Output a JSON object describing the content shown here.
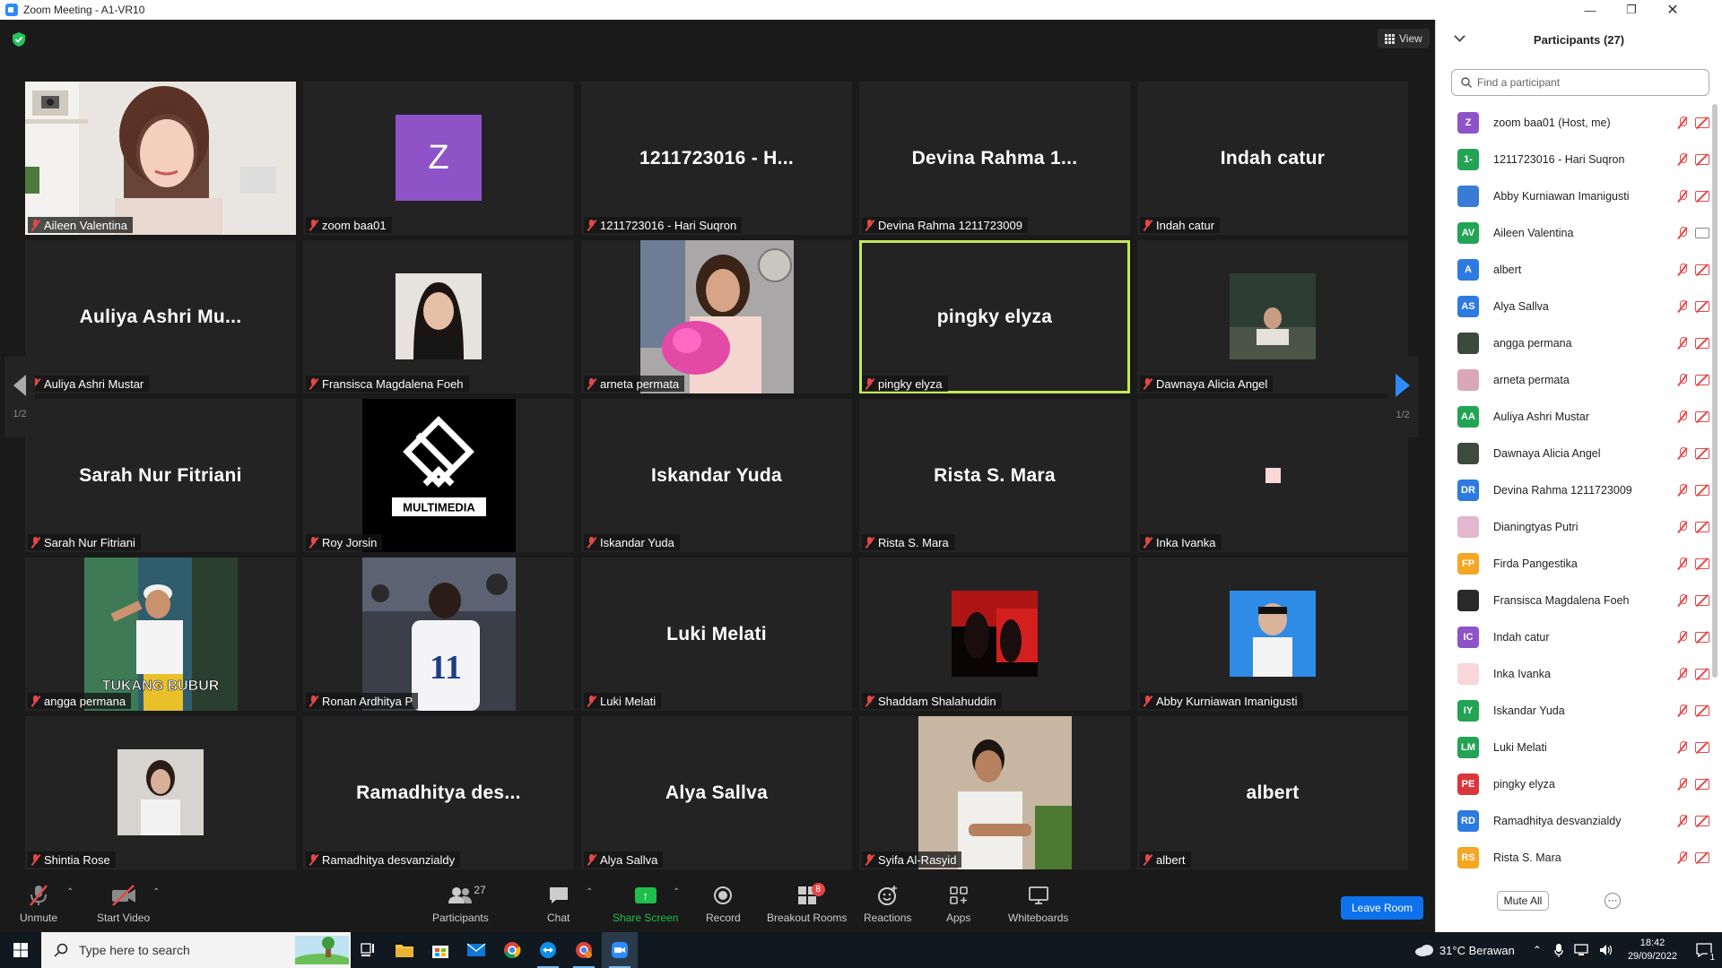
{
  "window": {
    "title": "Zoom Meeting - A1-VR10"
  },
  "meeting": {
    "view_label": "View",
    "page_indicator_left": "1/2",
    "page_indicator_right": "1/2",
    "tiles": [
      {
        "name": "Aileen Valentina",
        "big": "",
        "kind": "photo-aileen"
      },
      {
        "name": "zoom baa01",
        "big": "",
        "kind": "avatar-z",
        "avatar_letter": "Z"
      },
      {
        "name": "1211723016 - Hari Suqron",
        "big": "1211723016 - H...",
        "kind": "name"
      },
      {
        "name": "Devina Rahma 1211723009",
        "big": "Devina Rahma 1...",
        "kind": "name"
      },
      {
        "name": "Indah catur",
        "big": "Indah catur",
        "kind": "name"
      },
      {
        "name": "Auliya Ashri Mustar",
        "big": "Auliya Ashri Mu...",
        "kind": "name"
      },
      {
        "name": "Fransisca Magdalena Foeh",
        "big": "",
        "kind": "photo-fransisca"
      },
      {
        "name": "arneta permata",
        "big": "",
        "kind": "photo-arneta"
      },
      {
        "name": "pingky elyza",
        "big": "pingky elyza",
        "kind": "name",
        "active": true
      },
      {
        "name": "Dawnaya Alicia Angel",
        "big": "",
        "kind": "photo-dawnaya"
      },
      {
        "name": "Sarah Nur Fitriani",
        "big": "Sarah Nur Fitriani",
        "kind": "name"
      },
      {
        "name": "Roy Jorsin",
        "big": "",
        "kind": "photo-roy",
        "logo_text": "MULTIMEDIA"
      },
      {
        "name": "Iskandar Yuda",
        "big": "Iskandar Yuda",
        "kind": "name"
      },
      {
        "name": "Rista S. Mara",
        "big": "Rista S. Mara",
        "kind": "name"
      },
      {
        "name": "Inka Ivanka",
        "big": "",
        "kind": "pink-square"
      },
      {
        "name": "angga permana",
        "big": "",
        "kind": "photo-angga",
        "overlay_text": "TUKANG BUBUR"
      },
      {
        "name": "Ronan Ardhitya P",
        "big": "",
        "kind": "photo-ronan",
        "jersey_number": "11"
      },
      {
        "name": "Luki Melati",
        "big": "Luki Melati",
        "kind": "name"
      },
      {
        "name": "Shaddam Shalahuddin",
        "big": "",
        "kind": "photo-shaddam"
      },
      {
        "name": "Abby Kurniawan Imanigusti",
        "big": "",
        "kind": "photo-abby"
      },
      {
        "name": "Shintia Rose",
        "big": "",
        "kind": "photo-shintia"
      },
      {
        "name": "Ramadhitya desvanzialdy",
        "big": "Ramadhitya des...",
        "kind": "name"
      },
      {
        "name": "Alya Sallva",
        "big": "Alya Sallva",
        "kind": "name"
      },
      {
        "name": "Syifa Al-Rasyid",
        "big": "",
        "kind": "photo-syifa"
      },
      {
        "name": "albert",
        "big": "albert",
        "kind": "name"
      }
    ]
  },
  "toolbar": {
    "unmute": "Unmute",
    "start_video": "Start Video",
    "participants": "Participants",
    "participants_count": "27",
    "chat": "Chat",
    "share_screen": "Share Screen",
    "record": "Record",
    "breakout_rooms": "Breakout Rooms",
    "breakout_badge": "8",
    "reactions": "Reactions",
    "apps": "Apps",
    "whiteboards": "Whiteboards",
    "leave": "Leave Room"
  },
  "panel": {
    "title": "Participants (27)",
    "search_placeholder": "Find a participant",
    "mute_all": "Mute All",
    "participants": [
      {
        "name": "zoom baa01 (Host, me)",
        "initials": "Z",
        "color": "#8e54c7",
        "camera_on": false
      },
      {
        "name": "1211723016 - Hari Suqron",
        "initials": "1-",
        "color": "#23a455",
        "camera_on": false
      },
      {
        "name": "Abby Kurniawan Imanigusti",
        "initials": "",
        "color": "#3a7bd5",
        "camera_on": false,
        "photo": true
      },
      {
        "name": "Aileen Valentina",
        "initials": "AV",
        "color": "#23a455",
        "camera_on": true
      },
      {
        "name": "albert",
        "initials": "A",
        "color": "#2d7be0",
        "camera_on": false
      },
      {
        "name": "Alya Sallva",
        "initials": "AS",
        "color": "#2d7be0",
        "camera_on": false
      },
      {
        "name": "angga permana",
        "initials": "",
        "color": "#3b4a3a",
        "camera_on": false,
        "photo": true
      },
      {
        "name": "arneta permata",
        "initials": "",
        "color": "#d9a7b8",
        "camera_on": false,
        "photo": true
      },
      {
        "name": "Auliya Ashri Mustar",
        "initials": "AA",
        "color": "#23a455",
        "camera_on": false
      },
      {
        "name": "Dawnaya Alicia Angel",
        "initials": "",
        "color": "#3d4a3e",
        "camera_on": false,
        "photo": true
      },
      {
        "name": "Devina Rahma 1211723009",
        "initials": "DR",
        "color": "#2d7be0",
        "camera_on": false
      },
      {
        "name": "Dianingtyas Putri",
        "initials": "",
        "color": "#e3b7d0",
        "camera_on": false,
        "photo": true
      },
      {
        "name": "Firda Pangestika",
        "initials": "FP",
        "color": "#f5a623",
        "camera_on": false
      },
      {
        "name": "Fransisca Magdalena Foeh",
        "initials": "",
        "color": "#2a2a2a",
        "camera_on": false,
        "photo": true
      },
      {
        "name": "Indah catur",
        "initials": "IC",
        "color": "#8e54c7",
        "camera_on": false
      },
      {
        "name": "Inka Ivanka",
        "initials": "",
        "color": "#f9d6d8",
        "camera_on": false
      },
      {
        "name": "Iskandar Yuda",
        "initials": "IY",
        "color": "#23a455",
        "camera_on": false
      },
      {
        "name": "Luki Melati",
        "initials": "LM",
        "color": "#23a455",
        "camera_on": false
      },
      {
        "name": "pingky elyza",
        "initials": "PE",
        "color": "#d9363e",
        "camera_on": false
      },
      {
        "name": "Ramadhitya desvanzialdy",
        "initials": "RD",
        "color": "#2d7be0",
        "camera_on": false
      },
      {
        "name": "Rista S. Mara",
        "initials": "RS",
        "color": "#f5a623",
        "camera_on": false
      }
    ]
  },
  "taskbar": {
    "search_placeholder": "Type here to search",
    "weather": "31°C  Berawan",
    "time": "18:42",
    "date": "29/09/2022",
    "notification_count": "1"
  }
}
